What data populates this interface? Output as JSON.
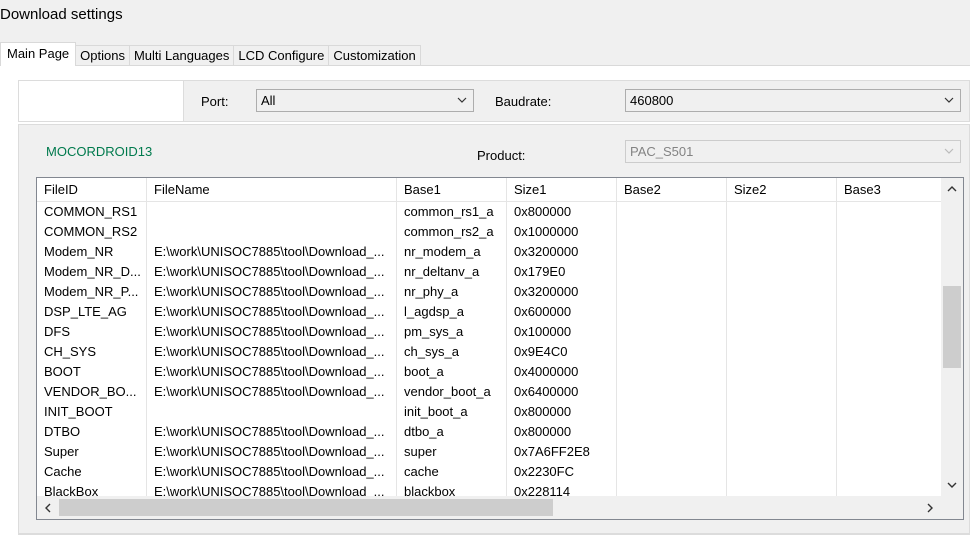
{
  "window": {
    "title": "Download settings"
  },
  "tabs": [
    {
      "label": "Main Page",
      "active": true
    },
    {
      "label": "Options"
    },
    {
      "label": "Multi Languages"
    },
    {
      "label": "LCD Configure"
    },
    {
      "label": "Customization"
    }
  ],
  "port": {
    "label": "Port:",
    "value": "All"
  },
  "baudrate": {
    "label": "Baudrate:",
    "value": "460800"
  },
  "product": {
    "brand": "MOCORDROID13",
    "label": "Product:",
    "value": "PAC_S501"
  },
  "table": {
    "columns": [
      "FileID",
      "FileName",
      "Base1",
      "Size1",
      "Base2",
      "Size2",
      "Base3"
    ],
    "rows": [
      [
        "COMMON_RS1",
        "",
        "common_rs1_a",
        "0x800000",
        "",
        "",
        ""
      ],
      [
        "COMMON_RS2",
        "",
        "common_rs2_a",
        "0x1000000",
        "",
        "",
        ""
      ],
      [
        "Modem_NR",
        "E:\\work\\UNISOC7885\\tool\\Download_...",
        "nr_modem_a",
        "0x3200000",
        "",
        "",
        ""
      ],
      [
        "Modem_NR_D...",
        "E:\\work\\UNISOC7885\\tool\\Download_...",
        "nr_deltanv_a",
        "0x179E0",
        "",
        "",
        ""
      ],
      [
        "Modem_NR_P...",
        "E:\\work\\UNISOC7885\\tool\\Download_...",
        "nr_phy_a",
        "0x3200000",
        "",
        "",
        ""
      ],
      [
        "DSP_LTE_AG",
        "E:\\work\\UNISOC7885\\tool\\Download_...",
        "l_agdsp_a",
        "0x600000",
        "",
        "",
        ""
      ],
      [
        "DFS",
        "E:\\work\\UNISOC7885\\tool\\Download_...",
        "pm_sys_a",
        "0x100000",
        "",
        "",
        ""
      ],
      [
        "CH_SYS",
        "E:\\work\\UNISOC7885\\tool\\Download_...",
        "ch_sys_a",
        "0x9E4C0",
        "",
        "",
        ""
      ],
      [
        "BOOT",
        "E:\\work\\UNISOC7885\\tool\\Download_...",
        "boot_a",
        "0x4000000",
        "",
        "",
        ""
      ],
      [
        "VENDOR_BO...",
        "E:\\work\\UNISOC7885\\tool\\Download_...",
        "vendor_boot_a",
        "0x6400000",
        "",
        "",
        ""
      ],
      [
        "INIT_BOOT",
        "",
        "init_boot_a",
        "0x800000",
        "",
        "",
        ""
      ],
      [
        "DTBO",
        "E:\\work\\UNISOC7885\\tool\\Download_...",
        "dtbo_a",
        "0x800000",
        "",
        "",
        ""
      ],
      [
        "Super",
        "E:\\work\\UNISOC7885\\tool\\Download_...",
        "super",
        "0x7A6FF2E8",
        "",
        "",
        ""
      ],
      [
        "Cache",
        "E:\\work\\UNISOC7885\\tool\\Download_...",
        "cache",
        "0x2230FC",
        "",
        "",
        ""
      ],
      [
        "BlackBox",
        "E:\\work\\UNISOC7885\\tool\\Download_...",
        "blackbox",
        "0x228114",
        "",
        "",
        ""
      ]
    ]
  },
  "icons": {
    "dropdown": "chevron-down-icon",
    "scroll_up": "chevron-up-icon",
    "scroll_down": "chevron-down-icon",
    "scroll_left": "chevron-left-icon",
    "scroll_right": "chevron-right-icon"
  },
  "colors": {
    "brand_text": "#007a4d",
    "disabled_text": "#838383"
  }
}
